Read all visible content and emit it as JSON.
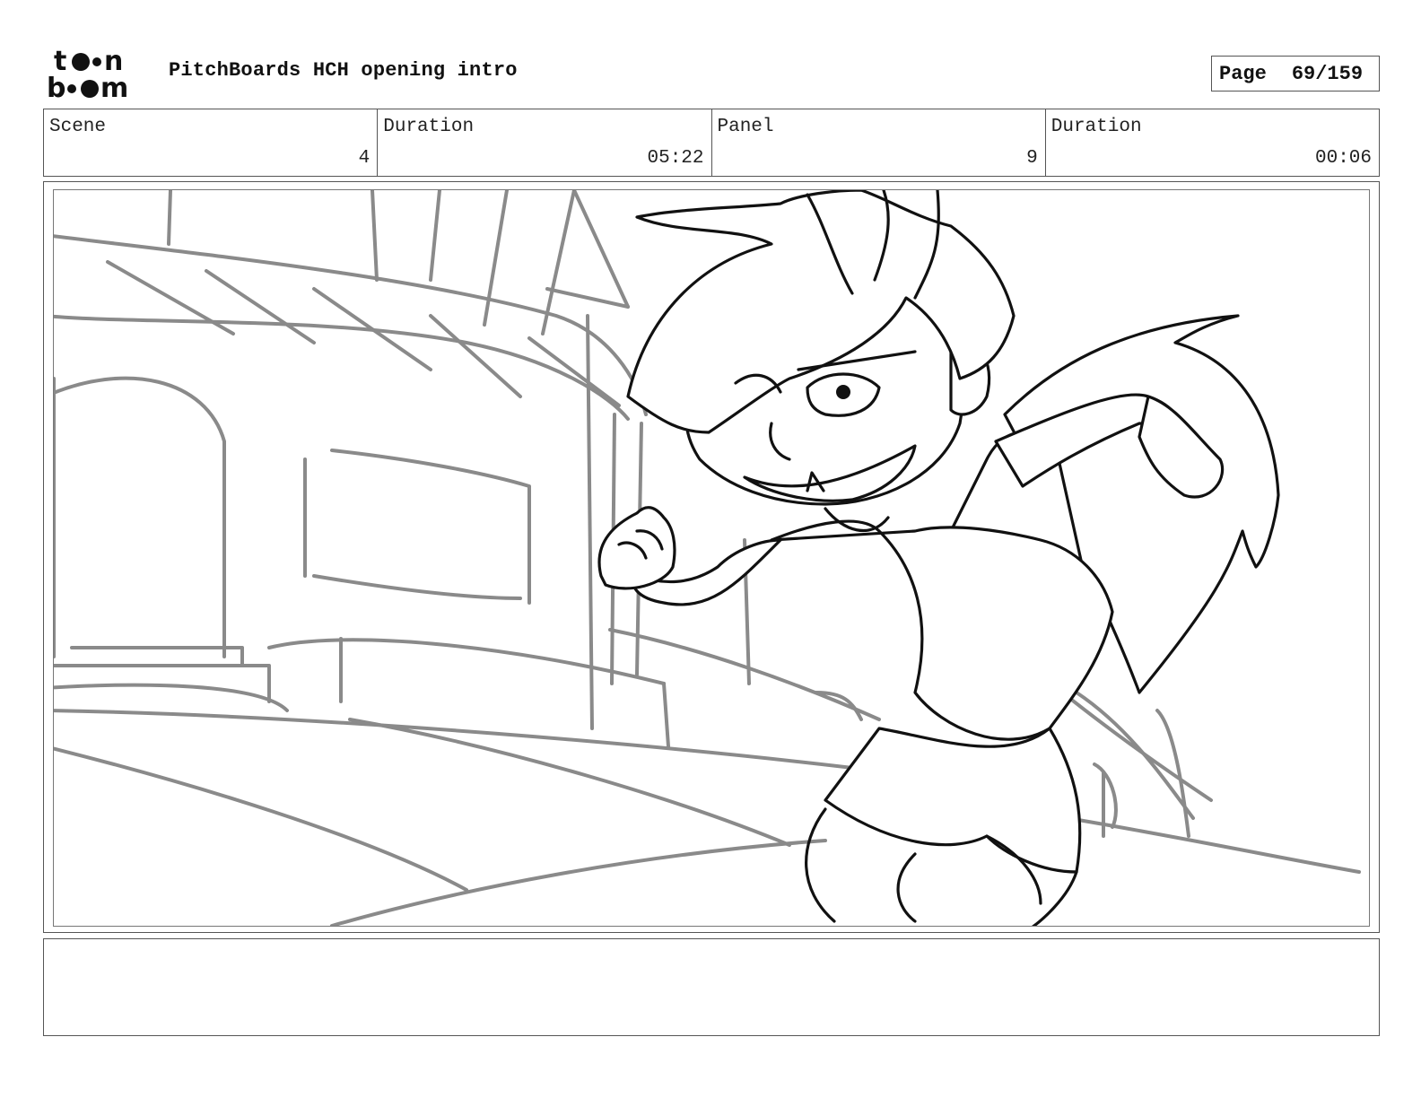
{
  "header": {
    "logo_text": "toon boom",
    "title": "PitchBoards HCH opening intro",
    "page_label": "Page",
    "page_value": "69/159"
  },
  "info": {
    "scene_label": "Scene",
    "scene_value": "4",
    "scene_duration_label": "Duration",
    "scene_duration_value": "05:22",
    "panel_label": "Panel",
    "panel_value": "9",
    "panel_duration_label": "Duration",
    "panel_duration_value": "00:06"
  },
  "notes": {
    "text": ""
  }
}
